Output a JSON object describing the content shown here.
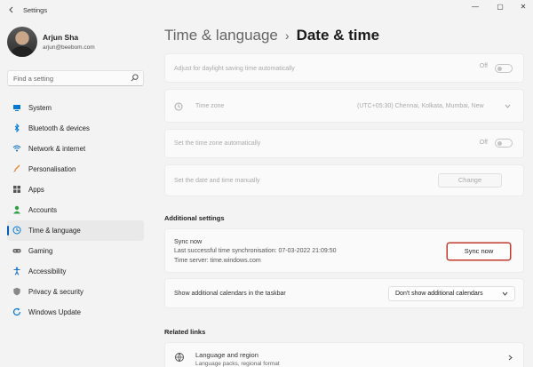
{
  "window": {
    "app_title": "Settings",
    "controls": [
      "—",
      "▢",
      "✕"
    ]
  },
  "user": {
    "name": "Arjun Sha",
    "email": "arjun@beebom.com"
  },
  "search": {
    "placeholder": "Find a setting"
  },
  "sidebar": {
    "items": [
      {
        "label": "System",
        "icon": "system-icon",
        "color": "#0078d4"
      },
      {
        "label": "Bluetooth & devices",
        "icon": "bluetooth-icon",
        "color": "#0078d4"
      },
      {
        "label": "Network & internet",
        "icon": "wifi-icon",
        "color": "#0067c0"
      },
      {
        "label": "Personalisation",
        "icon": "brush-icon",
        "color": "#e38a3a"
      },
      {
        "label": "Apps",
        "icon": "apps-icon",
        "color": "#555555"
      },
      {
        "label": "Accounts",
        "icon": "accounts-icon",
        "color": "#2ea043"
      },
      {
        "label": "Time & language",
        "icon": "globe-clock-icon",
        "color": "#0078d4"
      },
      {
        "label": "Gaming",
        "icon": "gamepad-icon",
        "color": "#666666"
      },
      {
        "label": "Accessibility",
        "icon": "accessibility-icon",
        "color": "#1a73c9"
      },
      {
        "label": "Privacy & security",
        "icon": "shield-icon",
        "color": "#888888"
      },
      {
        "label": "Windows Update",
        "icon": "update-icon",
        "color": "#0078d4"
      }
    ],
    "active_index": 6
  },
  "header": {
    "parent": "Time & language",
    "separator": "›",
    "current": "Date & time"
  },
  "settings": {
    "daylight": {
      "label": "Adjust for daylight saving time automatically",
      "state": "Off"
    },
    "timezone": {
      "label": "Time zone",
      "value": "(UTC+05:30) Chennai, Kolkata, Mumbai, New"
    },
    "auto_timezone": {
      "label": "Set the time zone automatically",
      "state": "Off"
    },
    "manual": {
      "label": "Set the date and time manually",
      "button": "Change"
    }
  },
  "additional": {
    "heading": "Additional settings",
    "sync_title": "Sync now",
    "sync_last": "Last successful time synchronisation: 07-03-2022 21:09:50",
    "sync_server": "Time server: time.windows.com",
    "sync_button": "Sync now",
    "calendars_label": "Show additional calendars in the taskbar",
    "calendars_value": "Don't show additional calendars"
  },
  "related": {
    "heading": "Related links",
    "item_title": "Language and region",
    "item_sub": "Language packs, regional format"
  },
  "colors": {
    "accent": "#005fb8",
    "highlight": "#c0392b"
  }
}
